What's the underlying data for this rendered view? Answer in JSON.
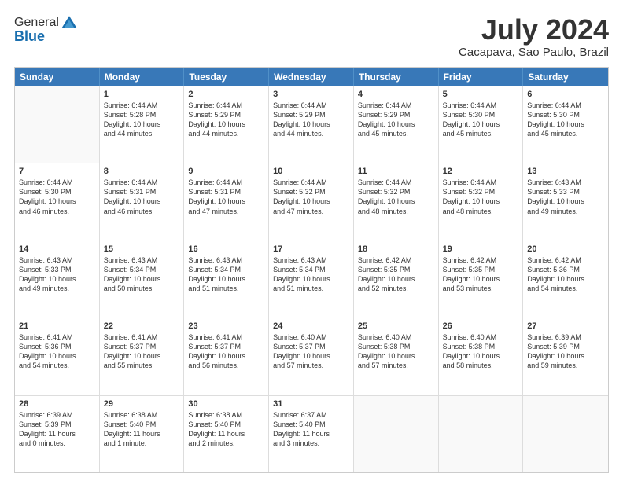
{
  "header": {
    "logo_line1": "General",
    "logo_line2": "Blue",
    "month": "July 2024",
    "location": "Cacapava, Sao Paulo, Brazil"
  },
  "days_of_week": [
    "Sunday",
    "Monday",
    "Tuesday",
    "Wednesday",
    "Thursday",
    "Friday",
    "Saturday"
  ],
  "rows": [
    [
      {
        "day": "",
        "info": ""
      },
      {
        "day": "1",
        "info": "Sunrise: 6:44 AM\nSunset: 5:28 PM\nDaylight: 10 hours\nand 44 minutes."
      },
      {
        "day": "2",
        "info": "Sunrise: 6:44 AM\nSunset: 5:29 PM\nDaylight: 10 hours\nand 44 minutes."
      },
      {
        "day": "3",
        "info": "Sunrise: 6:44 AM\nSunset: 5:29 PM\nDaylight: 10 hours\nand 44 minutes."
      },
      {
        "day": "4",
        "info": "Sunrise: 6:44 AM\nSunset: 5:29 PM\nDaylight: 10 hours\nand 45 minutes."
      },
      {
        "day": "5",
        "info": "Sunrise: 6:44 AM\nSunset: 5:30 PM\nDaylight: 10 hours\nand 45 minutes."
      },
      {
        "day": "6",
        "info": "Sunrise: 6:44 AM\nSunset: 5:30 PM\nDaylight: 10 hours\nand 45 minutes."
      }
    ],
    [
      {
        "day": "7",
        "info": "Sunrise: 6:44 AM\nSunset: 5:30 PM\nDaylight: 10 hours\nand 46 minutes."
      },
      {
        "day": "8",
        "info": "Sunrise: 6:44 AM\nSunset: 5:31 PM\nDaylight: 10 hours\nand 46 minutes."
      },
      {
        "day": "9",
        "info": "Sunrise: 6:44 AM\nSunset: 5:31 PM\nDaylight: 10 hours\nand 47 minutes."
      },
      {
        "day": "10",
        "info": "Sunrise: 6:44 AM\nSunset: 5:32 PM\nDaylight: 10 hours\nand 47 minutes."
      },
      {
        "day": "11",
        "info": "Sunrise: 6:44 AM\nSunset: 5:32 PM\nDaylight: 10 hours\nand 48 minutes."
      },
      {
        "day": "12",
        "info": "Sunrise: 6:44 AM\nSunset: 5:32 PM\nDaylight: 10 hours\nand 48 minutes."
      },
      {
        "day": "13",
        "info": "Sunrise: 6:43 AM\nSunset: 5:33 PM\nDaylight: 10 hours\nand 49 minutes."
      }
    ],
    [
      {
        "day": "14",
        "info": "Sunrise: 6:43 AM\nSunset: 5:33 PM\nDaylight: 10 hours\nand 49 minutes."
      },
      {
        "day": "15",
        "info": "Sunrise: 6:43 AM\nSunset: 5:34 PM\nDaylight: 10 hours\nand 50 minutes."
      },
      {
        "day": "16",
        "info": "Sunrise: 6:43 AM\nSunset: 5:34 PM\nDaylight: 10 hours\nand 51 minutes."
      },
      {
        "day": "17",
        "info": "Sunrise: 6:43 AM\nSunset: 5:34 PM\nDaylight: 10 hours\nand 51 minutes."
      },
      {
        "day": "18",
        "info": "Sunrise: 6:42 AM\nSunset: 5:35 PM\nDaylight: 10 hours\nand 52 minutes."
      },
      {
        "day": "19",
        "info": "Sunrise: 6:42 AM\nSunset: 5:35 PM\nDaylight: 10 hours\nand 53 minutes."
      },
      {
        "day": "20",
        "info": "Sunrise: 6:42 AM\nSunset: 5:36 PM\nDaylight: 10 hours\nand 54 minutes."
      }
    ],
    [
      {
        "day": "21",
        "info": "Sunrise: 6:41 AM\nSunset: 5:36 PM\nDaylight: 10 hours\nand 54 minutes."
      },
      {
        "day": "22",
        "info": "Sunrise: 6:41 AM\nSunset: 5:37 PM\nDaylight: 10 hours\nand 55 minutes."
      },
      {
        "day": "23",
        "info": "Sunrise: 6:41 AM\nSunset: 5:37 PM\nDaylight: 10 hours\nand 56 minutes."
      },
      {
        "day": "24",
        "info": "Sunrise: 6:40 AM\nSunset: 5:37 PM\nDaylight: 10 hours\nand 57 minutes."
      },
      {
        "day": "25",
        "info": "Sunrise: 6:40 AM\nSunset: 5:38 PM\nDaylight: 10 hours\nand 57 minutes."
      },
      {
        "day": "26",
        "info": "Sunrise: 6:40 AM\nSunset: 5:38 PM\nDaylight: 10 hours\nand 58 minutes."
      },
      {
        "day": "27",
        "info": "Sunrise: 6:39 AM\nSunset: 5:39 PM\nDaylight: 10 hours\nand 59 minutes."
      }
    ],
    [
      {
        "day": "28",
        "info": "Sunrise: 6:39 AM\nSunset: 5:39 PM\nDaylight: 11 hours\nand 0 minutes."
      },
      {
        "day": "29",
        "info": "Sunrise: 6:38 AM\nSunset: 5:40 PM\nDaylight: 11 hours\nand 1 minute."
      },
      {
        "day": "30",
        "info": "Sunrise: 6:38 AM\nSunset: 5:40 PM\nDaylight: 11 hours\nand 2 minutes."
      },
      {
        "day": "31",
        "info": "Sunrise: 6:37 AM\nSunset: 5:40 PM\nDaylight: 11 hours\nand 3 minutes."
      },
      {
        "day": "",
        "info": ""
      },
      {
        "day": "",
        "info": ""
      },
      {
        "day": "",
        "info": ""
      }
    ]
  ]
}
